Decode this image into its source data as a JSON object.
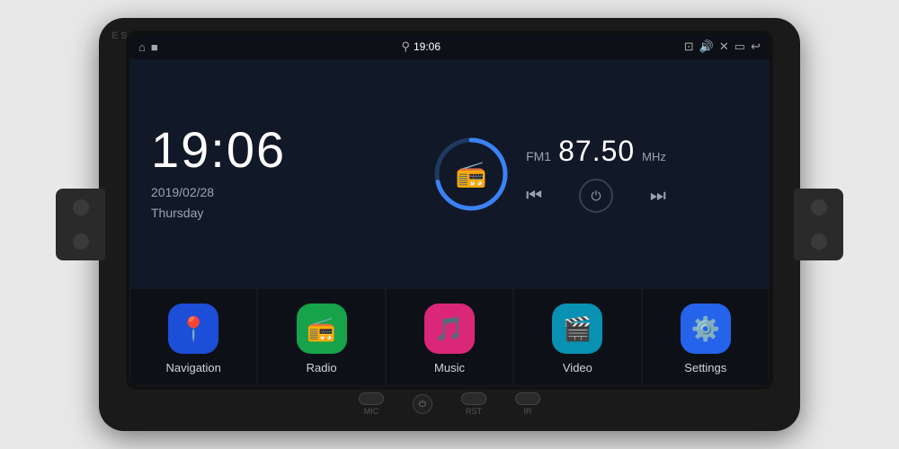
{
  "unit": {
    "watermark": "ESEDE"
  },
  "statusBar": {
    "leftIcons": [
      "🏠",
      "■"
    ],
    "time": "19:06",
    "locationIcon": "📍",
    "rightIcons": [
      "📷",
      "🔊",
      "✕",
      "▭",
      "↩"
    ]
  },
  "clock": {
    "time": "19:06",
    "date": "2019/02/28",
    "day": "Thursday"
  },
  "radio": {
    "band": "FM1",
    "frequency": "87.50",
    "unit": "MHz"
  },
  "apps": [
    {
      "id": "navigation",
      "label": "Navigation",
      "iconClass": "icon-nav",
      "icon": "📍"
    },
    {
      "id": "radio",
      "label": "Radio",
      "iconClass": "icon-radio",
      "icon": "📻"
    },
    {
      "id": "music",
      "label": "Music",
      "iconClass": "icon-music",
      "icon": "🎵"
    },
    {
      "id": "video",
      "label": "Video",
      "iconClass": "icon-video",
      "icon": "🎬"
    },
    {
      "id": "settings",
      "label": "Settings",
      "iconClass": "icon-settings",
      "icon": "⚙️"
    }
  ],
  "bottomBar": {
    "mic": "MIC",
    "rst": "RST",
    "ir": "IR"
  }
}
